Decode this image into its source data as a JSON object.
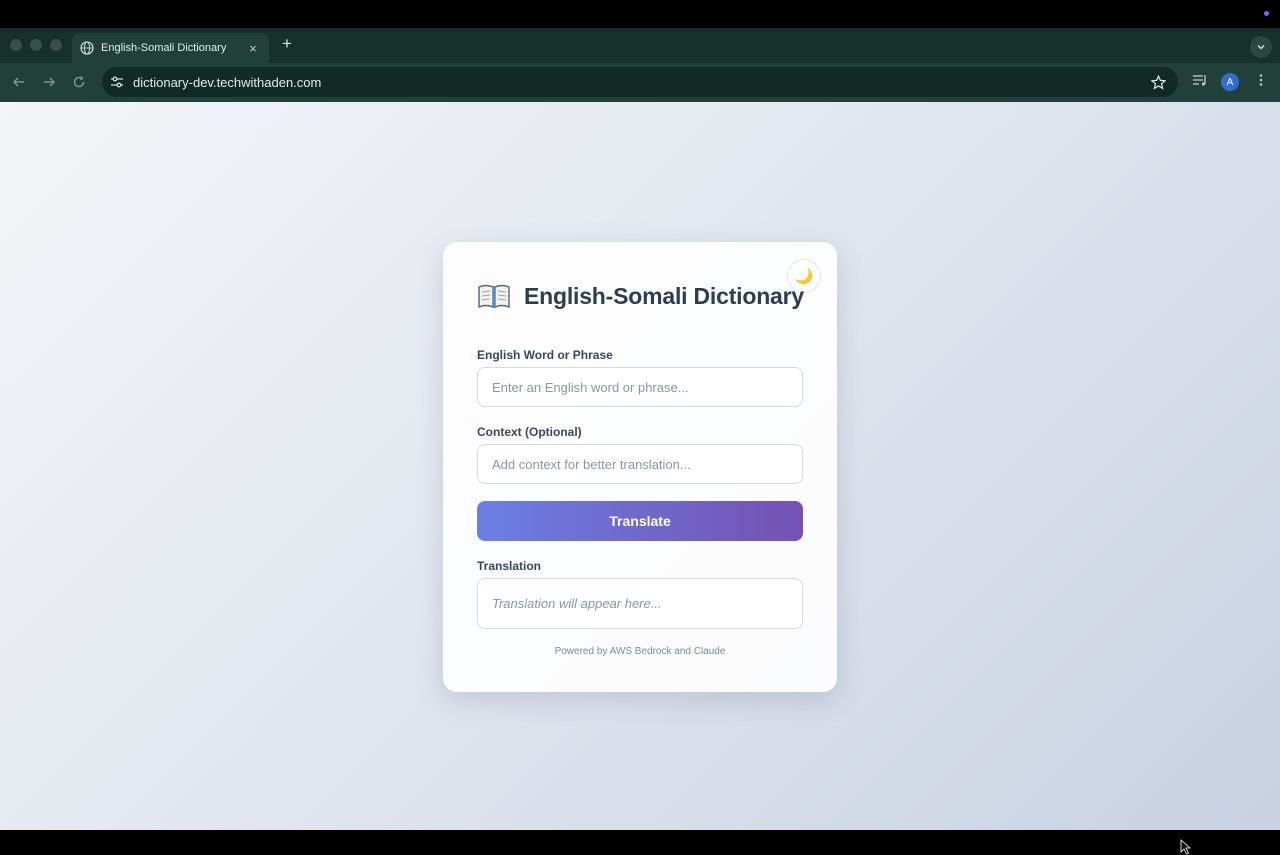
{
  "browser": {
    "tab_title": "English-Somali Dictionary",
    "new_tab": "+",
    "tab_close": "×",
    "url": "dictionary-dev.techwithaden.com",
    "profile_initial": "A"
  },
  "app": {
    "title": "English-Somali Dictionary",
    "theme_toggle_icon": "🌙",
    "word_label": "English Word or Phrase",
    "word_placeholder": "Enter an English word or phrase...",
    "context_label": "Context (Optional)",
    "context_placeholder": "Add context for better translation...",
    "translate_button": "Translate",
    "translation_label": "Translation",
    "translation_placeholder": "Translation will appear here...",
    "footer": "Powered by AWS Bedrock and Claude"
  },
  "colors": {
    "button_gradient_start": "#6b7fe3",
    "button_gradient_end": "#7452b3",
    "title_color": "#2c3e50",
    "browser_frame": "#21403a"
  }
}
